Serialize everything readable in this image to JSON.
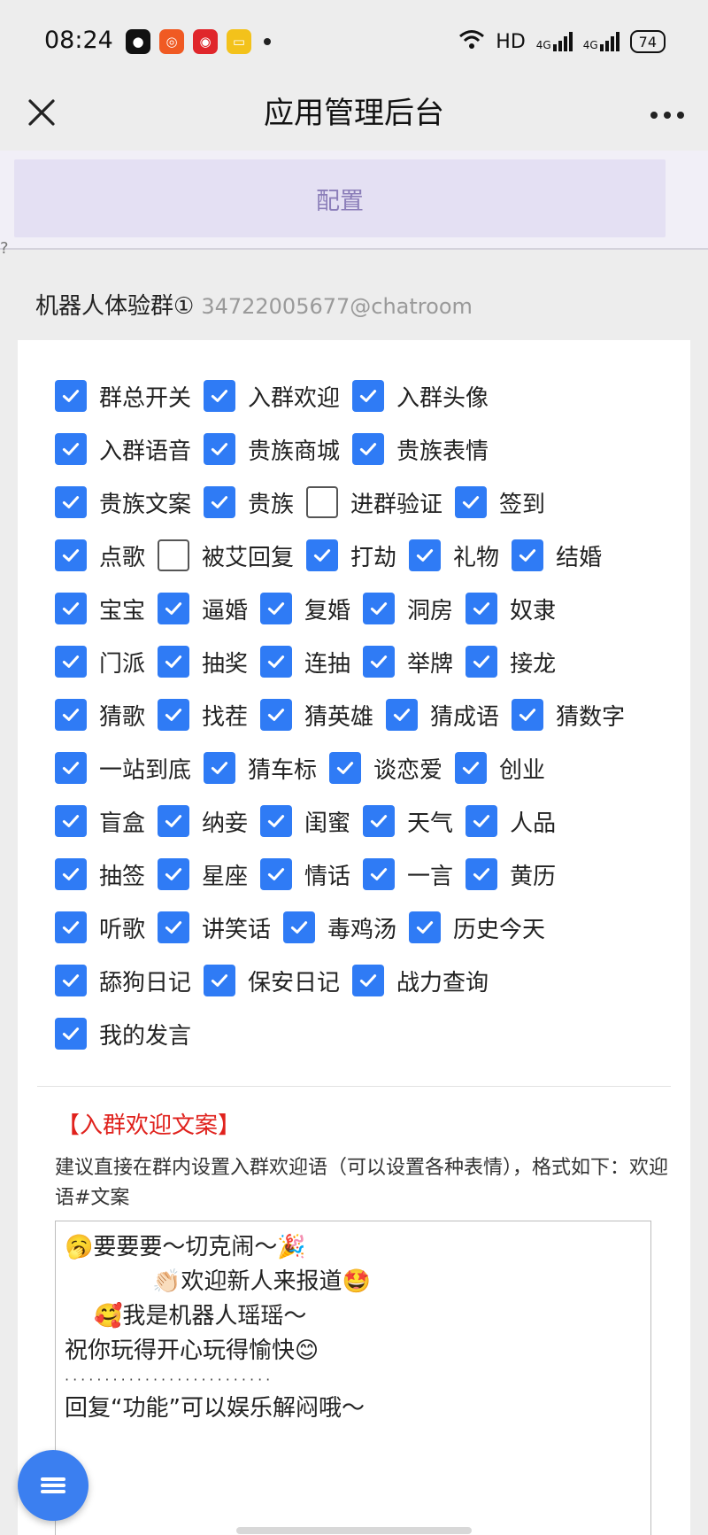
{
  "status_bar": {
    "time": "08:24",
    "apps": [
      {
        "icon": "wechat-icon",
        "glyph": "●",
        "color": "#111111"
      },
      {
        "icon": "game-app-icon",
        "glyph": "◎",
        "color": "#f05a23"
      },
      {
        "icon": "music-app-icon",
        "glyph": "◉",
        "color": "#e0262b"
      },
      {
        "icon": "notes-app-icon",
        "glyph": "▭",
        "color": "#f3c21b"
      }
    ],
    "network": "HD",
    "signal_1": "4G",
    "signal_2": "4G",
    "battery": "74"
  },
  "nav": {
    "title": "应用管理后台"
  },
  "config_button": "配置",
  "question_mark": "?",
  "group": {
    "name": "机器人体验群①",
    "id": "34722005677@chatroom"
  },
  "features": [
    [
      {
        "label": "群总开关",
        "checked": true
      },
      {
        "label": "入群欢迎",
        "checked": true
      },
      {
        "label": "入群头像",
        "checked": true
      }
    ],
    [
      {
        "label": "入群语音",
        "checked": true
      },
      {
        "label": "贵族商城",
        "checked": true
      },
      {
        "label": "贵族表情",
        "checked": true
      }
    ],
    [
      {
        "label": "贵族文案",
        "checked": true
      },
      {
        "label": "贵族",
        "checked": true
      },
      {
        "label": "进群验证",
        "checked": false
      },
      {
        "label": "签到",
        "checked": true
      }
    ],
    [
      {
        "label": "点歌",
        "checked": true
      },
      {
        "label": "被艾回复",
        "checked": false
      },
      {
        "label": "打劫",
        "checked": true
      },
      {
        "label": "礼物",
        "checked": true
      },
      {
        "label": "结婚",
        "checked": true
      }
    ],
    [
      {
        "label": "宝宝",
        "checked": true
      },
      {
        "label": "逼婚",
        "checked": true
      },
      {
        "label": "复婚",
        "checked": true
      },
      {
        "label": "洞房",
        "checked": true
      },
      {
        "label": "奴隶",
        "checked": true
      }
    ],
    [
      {
        "label": "门派",
        "checked": true
      },
      {
        "label": "抽奖",
        "checked": true
      },
      {
        "label": "连抽",
        "checked": true
      },
      {
        "label": "举牌",
        "checked": true
      },
      {
        "label": "接龙",
        "checked": true
      }
    ],
    [
      {
        "label": "猜歌",
        "checked": true
      },
      {
        "label": "找茬",
        "checked": true
      },
      {
        "label": "猜英雄",
        "checked": true
      },
      {
        "label": "猜成语",
        "checked": true
      },
      {
        "label": "猜数字",
        "checked": true
      }
    ],
    [
      {
        "label": "一站到底",
        "checked": true
      },
      {
        "label": "猜车标",
        "checked": true
      },
      {
        "label": "谈恋爱",
        "checked": true
      },
      {
        "label": "创业",
        "checked": true
      }
    ],
    [
      {
        "label": "盲盒",
        "checked": true
      },
      {
        "label": "纳妾",
        "checked": true
      },
      {
        "label": "闺蜜",
        "checked": true
      },
      {
        "label": "天气",
        "checked": true
      },
      {
        "label": "人品",
        "checked": true
      }
    ],
    [
      {
        "label": "抽签",
        "checked": true
      },
      {
        "label": "星座",
        "checked": true
      },
      {
        "label": "情话",
        "checked": true
      },
      {
        "label": "一言",
        "checked": true
      },
      {
        "label": "黄历",
        "checked": true
      }
    ],
    [
      {
        "label": "听歌",
        "checked": true
      },
      {
        "label": "讲笑话",
        "checked": true
      },
      {
        "label": "毒鸡汤",
        "checked": true
      },
      {
        "label": "历史今天",
        "checked": true
      }
    ],
    [
      {
        "label": "舔狗日记",
        "checked": true
      },
      {
        "label": "保安日记",
        "checked": true
      },
      {
        "label": "战力查询",
        "checked": true
      }
    ],
    [
      {
        "label": "我的发言",
        "checked": true
      }
    ]
  ],
  "welcome": {
    "title": "【入群欢迎文案】",
    "description": "建议直接在群内设置入群欢迎语（可以设置各种表情），格式如下：欢迎语#文案",
    "lines": [
      "🥱要要要～切克闹～🎉",
      "            👏🏻欢迎新人来报道🤩",
      "    🥰我是机器人瑶瑶～",
      "祝你玩得开心玩得愉快😊",
      "··························",
      "回复“功能”可以娱乐解闷哦～"
    ]
  }
}
